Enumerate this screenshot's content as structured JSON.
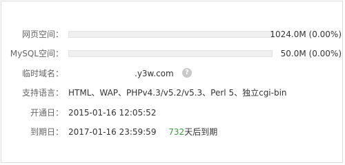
{
  "web_space": {
    "label": "网页空间：",
    "usage": "1024.0M (0.00%)",
    "used_fraction": 0.0
  },
  "mysql_space": {
    "label": "MySQL空间：",
    "usage": "50.0M (0.00%)",
    "used_fraction": 0.0
  },
  "temp_domain": {
    "label": "临时域名：",
    "value_visible_suffix": ".y3w.com",
    "help_icon": "question-circle-icon",
    "help_glyph": "?"
  },
  "languages": {
    "label": "支持语言：",
    "value": "HTML、WAP、PHPv4.3/v5.2/v5.3、Perl 5、独立cgi-bin"
  },
  "open_date": {
    "label": "开通日：",
    "value": "2015-01-16 12:05:52"
  },
  "expire_date": {
    "label": "到期日：",
    "value": "2017-01-16 23:59:59",
    "days_left": "732",
    "days_suffix": "天后到期"
  },
  "colors": {
    "days_left": "#3a9a3a",
    "bar_background": "#efefef"
  }
}
